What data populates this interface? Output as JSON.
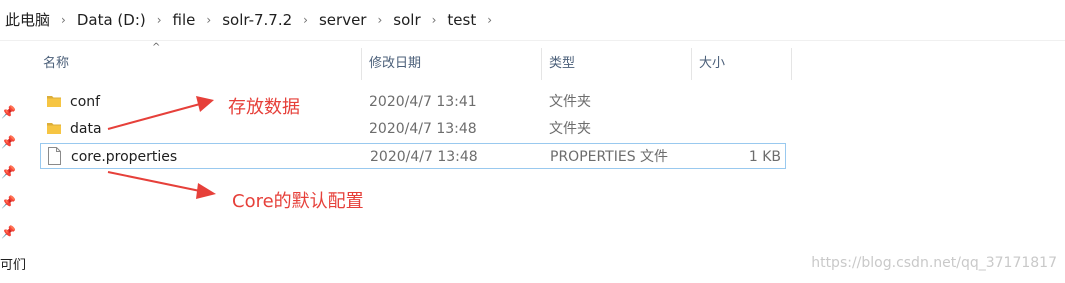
{
  "breadcrumb": [
    "此电脑",
    "Data (D:)",
    "file",
    "solr-7.7.2",
    "server",
    "solr",
    "test"
  ],
  "breadcrumb_separator": "›",
  "columns": {
    "name": "名称",
    "date": "修改日期",
    "type": "类型",
    "size": "大小"
  },
  "files": [
    {
      "name": "conf",
      "date": "2020/4/7 13:41",
      "type": "文件夹",
      "size": "",
      "icon": "folder-icon"
    },
    {
      "name": "data",
      "date": "2020/4/7 13:48",
      "type": "文件夹",
      "size": "",
      "icon": "folder-icon"
    },
    {
      "name": "core.properties",
      "date": "2020/4/7 13:48",
      "type": "PROPERTIES 文件",
      "size": "1 KB",
      "icon": "file-icon",
      "selected": true
    }
  ],
  "left_pane": {
    "partial_label": "可们"
  },
  "annotations": {
    "data_note": "存放数据",
    "core_note": "Core的默认配置"
  },
  "watermark": "https://blog.csdn.net/qq_37171817",
  "colors": {
    "annotation": "#e6403a",
    "folder": "#f6c543",
    "selection_border": "#99c9ef"
  }
}
